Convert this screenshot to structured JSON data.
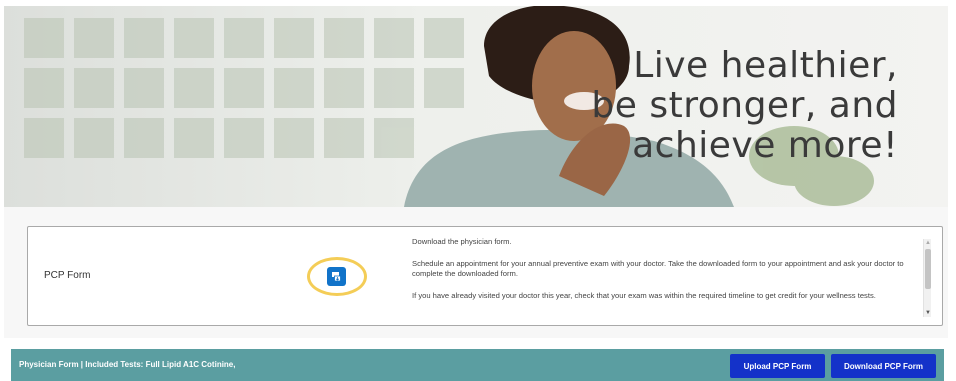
{
  "hero": {
    "headline_lines": [
      "Live healthier,",
      "be stronger, and",
      "achieve more!"
    ]
  },
  "pcp_card": {
    "label": "PCP Form",
    "download_icon": "download-form-icon",
    "instructions": [
      "Download the physician form.",
      "Schedule an appointment for your annual preventive exam with your doctor. Take the downloaded form to your appointment and ask your doctor to complete the downloaded form.",
      "If you have already visited your doctor this year, check that your exam was within the required timeline to get credit for your wellness tests."
    ]
  },
  "bottom_bar": {
    "text": "Physician Form | Included Tests: Full Lipid A1C Cotinine,",
    "upload_label": "Upload PCP Form",
    "download_label": "Download PCP Form"
  },
  "colors": {
    "primary_button": "#1432c9",
    "bar": "#5b9ea1",
    "download_icon_bg": "#1173c9",
    "highlight": "#f4cd57"
  }
}
